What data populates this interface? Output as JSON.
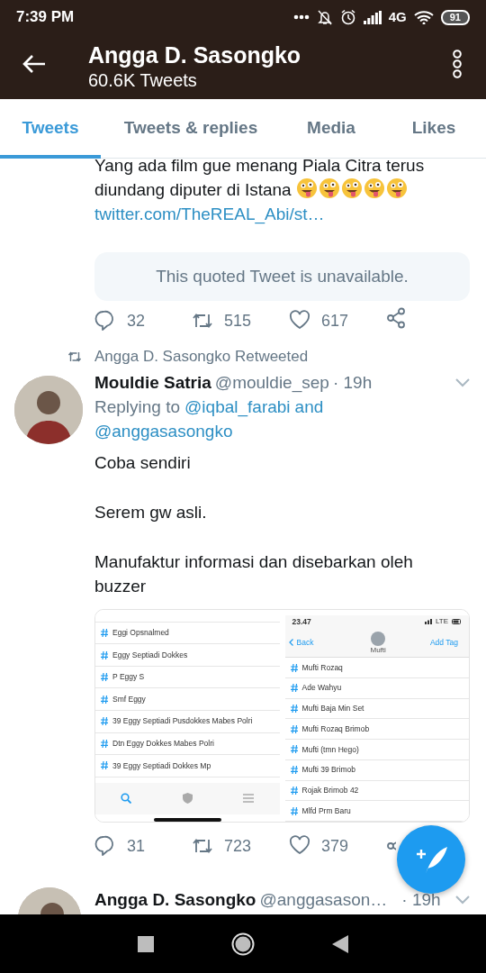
{
  "status_bar": {
    "time": "7:39 PM",
    "network": "4G",
    "battery": "91"
  },
  "header": {
    "title": "Angga D. Sasongko",
    "subtitle": "60.6K Tweets"
  },
  "tabs": [
    {
      "label": "Tweets",
      "selected": true
    },
    {
      "label": "Tweets & replies",
      "selected": false
    },
    {
      "label": "Media",
      "selected": false
    },
    {
      "label": "Likes",
      "selected": false
    }
  ],
  "timeline": [
    {
      "kind": "continued",
      "text": "Yang ada film gue menang Piala Citra terus diundang diputer di Istana",
      "emojis": [
        {
          "kind": "zany"
        },
        {
          "kind": "zany"
        },
        {
          "kind": "zany"
        },
        {
          "kind": "zany"
        },
        {
          "kind": "zany"
        }
      ],
      "link": "twitter.com/TheREAL_Abi/st…",
      "quoted_tweet": "This quoted Tweet is unavailable.",
      "actions": {
        "reply": "32",
        "retweet": "515",
        "like": "617"
      }
    },
    {
      "kind": "retweet",
      "social_context": "Angga D. Sasongko Retweeted",
      "name": "Mouldie Satria",
      "handle": "@mouldie_sep",
      "time": "· 19h",
      "reply_prefix": "Replying to",
      "mentions": [
        "@iqbal_farabi",
        "and",
        "@anggasasongko"
      ],
      "paragraphs": [
        "Coba sendiri",
        "Serem gw asli.",
        "Manufaktur informasi dan disebarkan oleh buzzer"
      ],
      "media": [
        {
          "kind": "tag_list",
          "items": [
            "Eggi Opsnalmed",
            "Eggy Septiadi Dokkes",
            "P Eggy S",
            "Smf Eggy",
            "39 Eggy Septiadi Pusdokkes Mabes Polri",
            "Dtn Eggy Dokkes Mabes Polri",
            "39 Eggy Septiadi Dokkes Mp"
          ]
        },
        {
          "kind": "tag_detail",
          "time": "23.47",
          "network": "LTE",
          "back": "Back",
          "title": "Mufti",
          "action": "Add Tag",
          "items": [
            "Mufti Rozaq",
            "Ade Wahyu",
            "Mufti Baja Min Set",
            "Mufti Rozaq Brimob",
            "Mufti (tmn Hego)",
            "Mufti 39 Brimob",
            "Rojak Brimob 42",
            "Mlfd Prm Baru"
          ]
        }
      ],
      "actions": {
        "reply": "31",
        "retweet": "723",
        "like": "379"
      }
    },
    {
      "kind": "header_only",
      "name": "Angga D. Sasongko",
      "handle": "@anggasason…",
      "time": "· 19h"
    }
  ]
}
